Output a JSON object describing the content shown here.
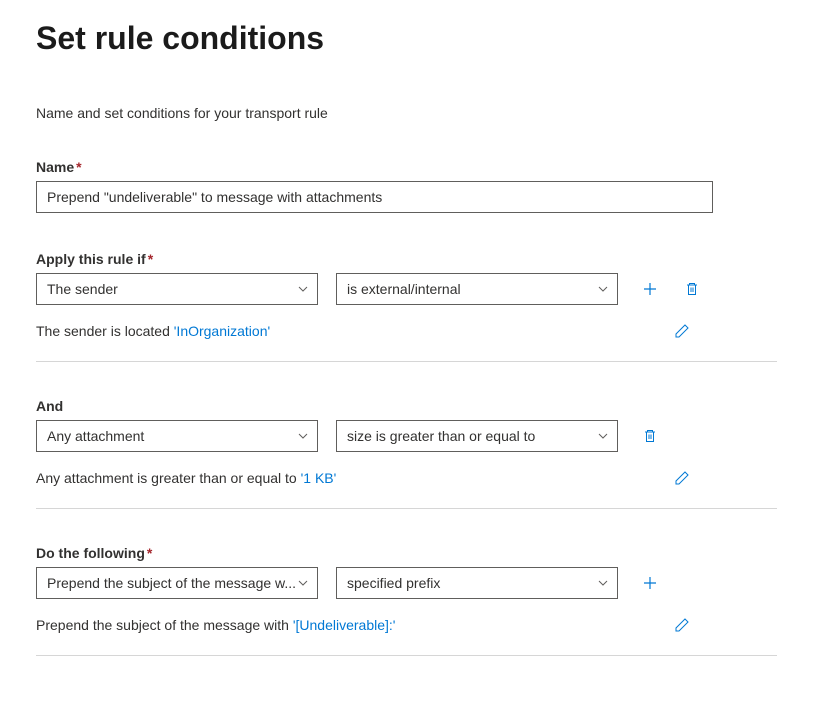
{
  "title": "Set rule conditions",
  "subtitle": "Name and set conditions for your transport rule",
  "name_label": "Name",
  "name_value": "Prepend \"undeliverable\" to message with attachments",
  "apply_if": {
    "label": "Apply this rule if",
    "select1": "The sender",
    "select2": "is external/internal",
    "summary_prefix": "The sender is located ",
    "summary_value": "'InOrganization'"
  },
  "and": {
    "label": "And",
    "select1": "Any attachment",
    "select2": "size is greater than or equal to",
    "summary_prefix": "Any attachment is greater than or equal to ",
    "summary_value": "'1 KB'"
  },
  "do_following": {
    "label": "Do the following",
    "select1": "Prepend the subject of the message w...",
    "select2": "specified prefix",
    "summary_prefix": "Prepend the subject of the message with ",
    "summary_value": "'[Undeliverable]:'"
  }
}
